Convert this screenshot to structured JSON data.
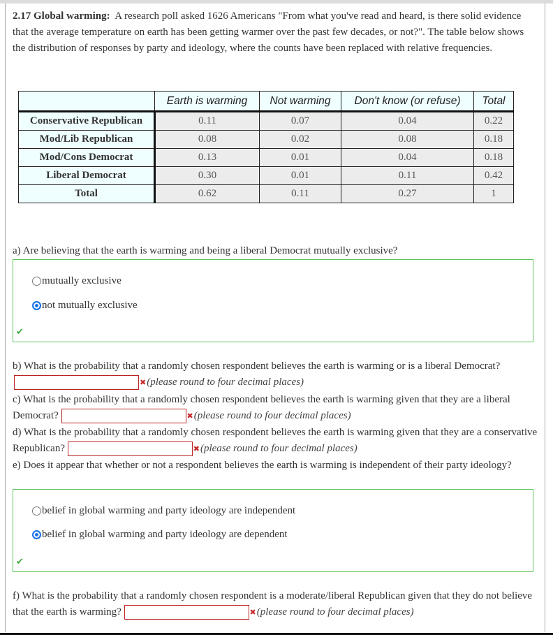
{
  "problem": {
    "number_title": "2.17 Global warming:",
    "intro": "A research poll asked 1626 Americans \"From what you've read and heard, is there solid evidence that the average temperature on earth has been getting warmer over the past few decades, or not?\". The table below shows the distribution of responses by party and ideology, where the counts have been replaced with relative frequencies."
  },
  "table": {
    "columns": [
      "Earth is warming",
      "Not warming",
      "Don't know (or refuse)",
      "Total"
    ],
    "rows": [
      {
        "label": "Conservative Republican",
        "values": [
          "0.11",
          "0.07",
          "0.04",
          "0.22"
        ]
      },
      {
        "label": "Mod/Lib Republican",
        "values": [
          "0.08",
          "0.02",
          "0.08",
          "0.18"
        ]
      },
      {
        "label": "Mod/Cons Democrat",
        "values": [
          "0.13",
          "0.01",
          "0.04",
          "0.18"
        ]
      },
      {
        "label": "Liberal Democrat",
        "values": [
          "0.30",
          "0.01",
          "0.11",
          "0.42"
        ]
      },
      {
        "label": "Total",
        "values": [
          "0.62",
          "0.11",
          "0.27",
          "1"
        ]
      }
    ]
  },
  "questions": {
    "a": {
      "text": "a) Are believing that the earth is warming and being a liberal Democrat mutually exclusive?",
      "options": [
        {
          "label": "mutually exclusive",
          "selected": false
        },
        {
          "label": "not mutually exclusive",
          "selected": true
        }
      ],
      "status": "correct"
    },
    "b": {
      "text": "b) What is the probability that a randomly chosen respondent believes the earth is warming or is a liberal Democrat?",
      "value": "",
      "hint": "(please round to four decimal places)",
      "status": "incorrect"
    },
    "c": {
      "text": "c) What is the probability that a randomly chosen respondent believes the earth is warming given that they are a liberal Democrat?",
      "value": "",
      "hint": "(please round to four decimal places)",
      "status": "incorrect"
    },
    "d": {
      "text": "d) What is the probability that a randomly chosen respondent believes the earth is warming given that they are a conservative Republican?",
      "value": "",
      "hint": "(please round to four decimal places)",
      "status": "incorrect"
    },
    "e": {
      "text": "e) Does it appear that whether or not a respondent believes the earth is warming is independent of their party ideology?",
      "options": [
        {
          "label": "belief in global warming and party ideology are independent",
          "selected": false
        },
        {
          "label": "belief in global warming and party ideology are dependent",
          "selected": true
        }
      ],
      "status": "correct"
    },
    "f": {
      "text": "f) What is the probability that a randomly chosen respondent is a moderate/liberal Republican given that they do not believe that the earth is warming?",
      "value": "",
      "hint": "(please round to four decimal places)",
      "status": "incorrect"
    }
  },
  "icons": {
    "correct": "✔",
    "incorrect": "✖"
  },
  "colors": {
    "correct_border": "#5dc45d",
    "incorrect_border": "#bb2222",
    "radio_selected": "#1a73e8",
    "header_bg": "#effeff",
    "cell_bg": "#ececec"
  }
}
